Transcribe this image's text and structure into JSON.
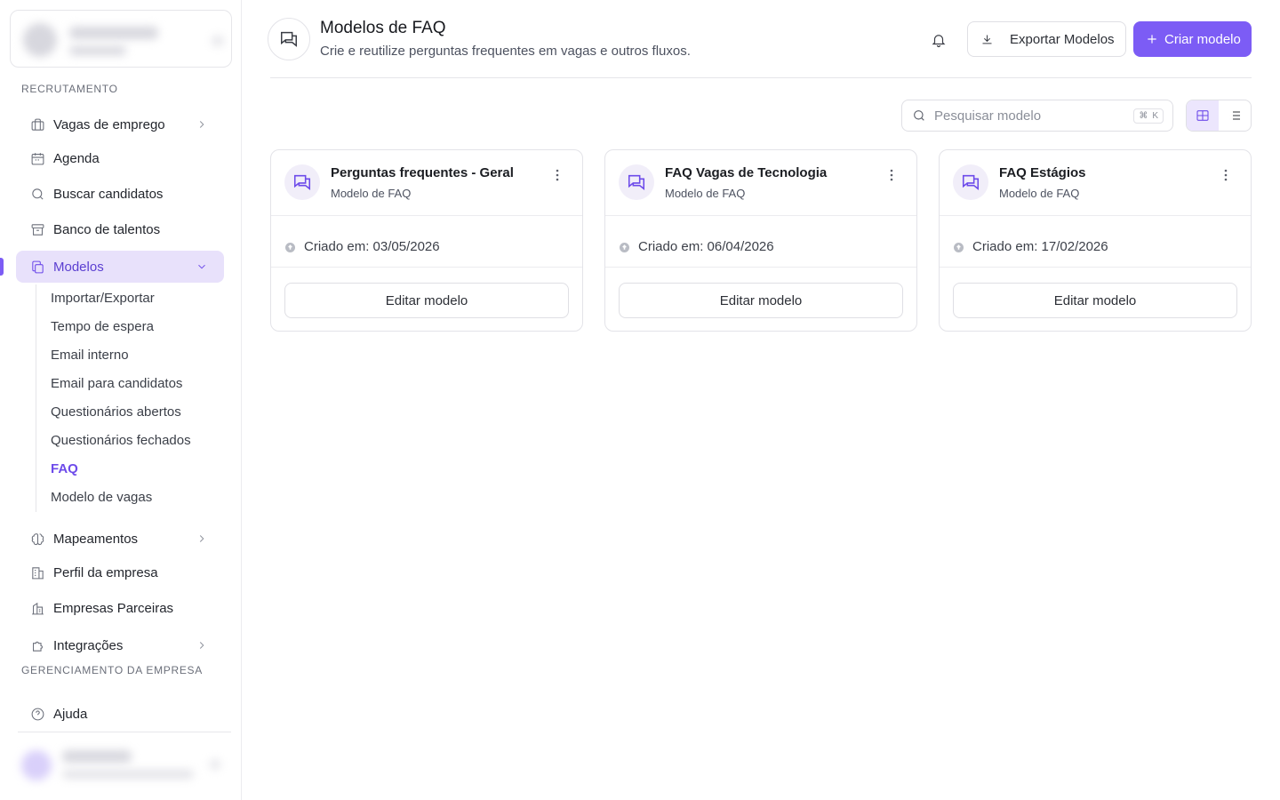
{
  "sidebar": {
    "section_recruitment": "RECRUTAMENTO",
    "section_management": "GERENCIAMENTO DA EMPRESA",
    "items": [
      {
        "label": "Vagas de emprego",
        "icon": "briefcase-icon"
      },
      {
        "label": "Agenda",
        "icon": "calendar-icon"
      },
      {
        "label": "Buscar candidatos",
        "icon": "search-icon"
      },
      {
        "label": "Banco de talentos",
        "icon": "archive-icon"
      },
      {
        "label": "Modelos",
        "icon": "copy-icon"
      },
      {
        "label": "Mapeamentos",
        "icon": "brain-icon"
      },
      {
        "label": "Perfil da empresa",
        "icon": "building-icon"
      },
      {
        "label": "Empresas Parceiras",
        "icon": "buildings-icon"
      },
      {
        "label": "Integrações",
        "icon": "puzzle-icon"
      },
      {
        "label": "Ajuda",
        "icon": "help-circle-icon"
      }
    ],
    "subitems": [
      "Importar/Exportar",
      "Tempo de espera",
      "Email interno",
      "Email para candidatos",
      "Questionários abertos",
      "Questionários fechados",
      "FAQ",
      "Modelo de vagas"
    ],
    "active_subitem": "FAQ"
  },
  "header": {
    "title": "Modelos de FAQ",
    "subtitle": "Crie e reutilize perguntas frequentes em vagas e outros fluxos.",
    "export_label": "Exportar Modelos",
    "create_label": "Criar modelo"
  },
  "toolbar": {
    "search_placeholder": "Pesquisar modelo",
    "shortcut_symbol": "⌘",
    "shortcut_key": "K",
    "view_mode": "grid"
  },
  "cards": [
    {
      "title": "Perguntas frequentes - Geral",
      "subtitle": "Modelo de FAQ",
      "created": "Criado em: 03/05/2026",
      "edit_label": "Editar modelo"
    },
    {
      "title": "FAQ Vagas de Tecnologia",
      "subtitle": "Modelo de FAQ",
      "created": "Criado em: 06/04/2026",
      "edit_label": "Editar modelo"
    },
    {
      "title": "FAQ Estágios",
      "subtitle": "Modelo de FAQ",
      "created": "Criado em: 17/02/2026",
      "edit_label": "Editar modelo"
    }
  ],
  "colors": {
    "accent": "#7c5cf5",
    "accent_soft": "#e8e1fb",
    "border": "#e3e3e8"
  }
}
